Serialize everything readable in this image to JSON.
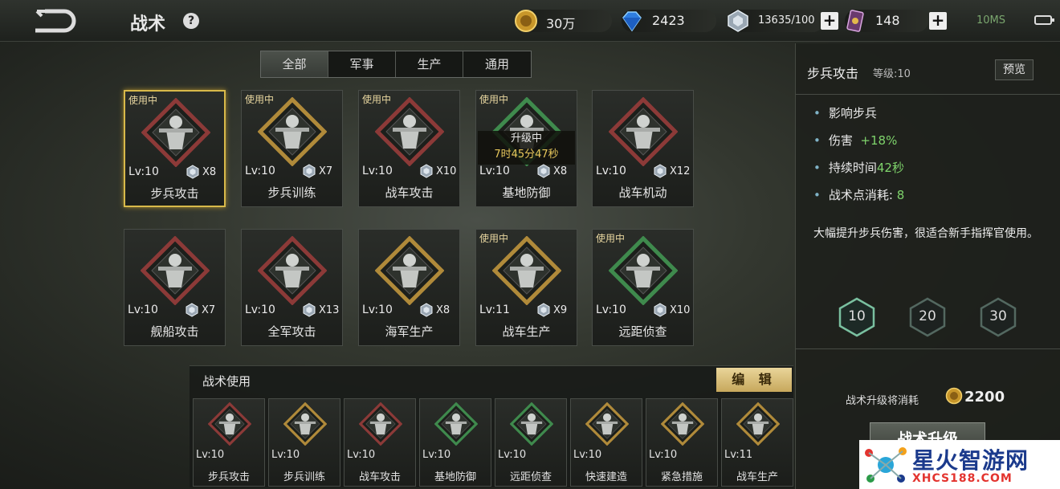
{
  "header": {
    "title": "战术",
    "help": "?",
    "ping": "10MS"
  },
  "resources": [
    {
      "icon": "gold-coin-icon",
      "value": "30万"
    },
    {
      "icon": "diamond-icon",
      "value": "2423"
    },
    {
      "icon": "silver-crystal-icon",
      "value": "13635/100"
    },
    {
      "icon": "card-ticket-icon",
      "value": "148"
    }
  ],
  "filters": {
    "items": [
      {
        "label": "全部"
      },
      {
        "label": "军事"
      },
      {
        "label": "生产"
      },
      {
        "label": "通用"
      }
    ],
    "active": "全部"
  },
  "cards": [
    {
      "name": "步兵攻击",
      "level": "Lv:10",
      "qty": "X8",
      "in_use": "使用中",
      "frame": "red",
      "icon": "infantry-attack-icon"
    },
    {
      "name": "步兵训练",
      "level": "Lv:10",
      "qty": "X7",
      "in_use": "使用中",
      "frame": "gold",
      "icon": "infantry-training-icon"
    },
    {
      "name": "战车攻击",
      "level": "Lv:10",
      "qty": "X10",
      "in_use": "使用中",
      "frame": "red",
      "icon": "tank-attack-icon"
    },
    {
      "name": "基地防御",
      "level": "Lv:10",
      "qty": "X8",
      "in_use": "使用中",
      "frame": "green",
      "icon": "base-defense-icon",
      "upgrading": "升级中",
      "timer": "7时45分47秒"
    },
    {
      "name": "战车机动",
      "level": "Lv:10",
      "qty": "X12",
      "in_use": "",
      "frame": "red",
      "icon": "tank-mobility-icon"
    },
    {
      "name": "舰船攻击",
      "level": "Lv:10",
      "qty": "X7",
      "in_use": "",
      "frame": "red",
      "icon": "ship-attack-icon"
    },
    {
      "name": "全军攻击",
      "level": "Lv:10",
      "qty": "X13",
      "in_use": "",
      "frame": "red",
      "icon": "all-army-attack-icon"
    },
    {
      "name": "海军生产",
      "level": "Lv:10",
      "qty": "X8",
      "in_use": "",
      "frame": "gold",
      "icon": "navy-production-icon"
    },
    {
      "name": "战车生产",
      "level": "Lv:11",
      "qty": "X9",
      "in_use": "使用中",
      "frame": "gold",
      "icon": "tank-production-icon"
    },
    {
      "name": "远距侦查",
      "level": "Lv:10",
      "qty": "X10",
      "in_use": "使用中",
      "frame": "green",
      "icon": "long-range-recon-icon"
    }
  ],
  "usage": {
    "title": "战术使用",
    "edit_label": "编 辑",
    "items": [
      {
        "name": "步兵攻击",
        "level": "Lv:10",
        "frame": "red"
      },
      {
        "name": "步兵训练",
        "level": "Lv:10",
        "frame": "gold"
      },
      {
        "name": "战车攻击",
        "level": "Lv:10",
        "frame": "red"
      },
      {
        "name": "基地防御",
        "level": "Lv:10",
        "frame": "green"
      },
      {
        "name": "远距侦查",
        "level": "Lv:10",
        "frame": "green"
      },
      {
        "name": "快速建造",
        "level": "Lv:10",
        "frame": "gold"
      },
      {
        "name": "紧急措施",
        "level": "Lv:10",
        "frame": "gold"
      },
      {
        "name": "战车生产",
        "level": "Lv:11",
        "frame": "gold"
      }
    ]
  },
  "detail": {
    "name": "步兵攻击",
    "level_label": "等级:10",
    "preview_label": "预览",
    "stats": {
      "target": "影响步兵",
      "damage_label": "伤害",
      "damage_value": "+18%",
      "duration_label": "持续时间",
      "duration_value": "42秒",
      "cost_label": "战术点消耗:",
      "cost_value": "8"
    },
    "description": "大幅提升步兵伤害，很适合新手指挥官使用。",
    "levels": [
      "10",
      "20",
      "30"
    ],
    "upgrade_cost_label": "战术升级将消耗",
    "upgrade_cost_value": "2200",
    "upgrade_button": "战术升级"
  },
  "watermark": {
    "title": "星火智游网",
    "url": "XHCS188.COM"
  },
  "colors": {
    "gold": "#d8b94a",
    "green": "#7ed36b",
    "frame_red": "#8c3a38",
    "frame_green": "#3f8a4d",
    "frame_gold": "#b08a3a"
  }
}
